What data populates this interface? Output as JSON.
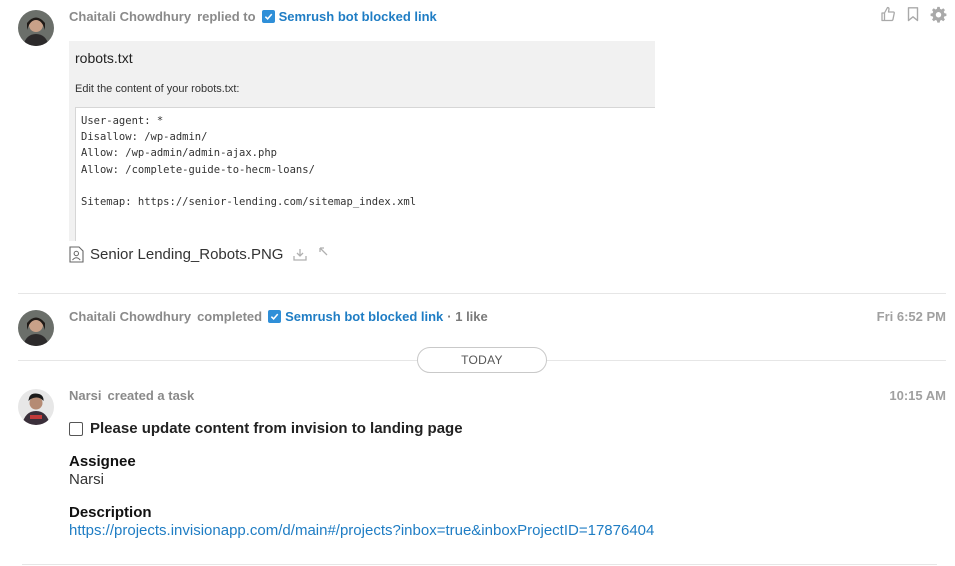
{
  "colors": {
    "accent": "#1f7dc4",
    "check_blue": "#2f8fd8",
    "meta_gray": "#8a8a8a",
    "divider": "#e6e6e6"
  },
  "entry1": {
    "author": "Chaitali Chowdhury",
    "action": "replied to",
    "task_name": "Semrush bot blocked link",
    "actions_icons": [
      "thumbs-up-icon",
      "bookmark-icon",
      "gear-icon"
    ],
    "screenshot": {
      "title": "robots.txt",
      "subtitle": "Edit the content of your robots.txt:",
      "content": "User-agent: *\nDisallow: /wp-admin/\nAllow: /wp-admin/admin-ajax.php\nAllow: /complete-guide-to-hecm-loans/\n\nSitemap: https://senior-lending.com/sitemap_index.xml"
    },
    "attachment": {
      "filename": "Senior Lending_Robots.PNG",
      "icons": [
        "image-file-icon",
        "download-icon",
        "expand-icon"
      ]
    }
  },
  "entry2": {
    "author": "Chaitali Chowdhury",
    "action": "completed",
    "task_name": "Semrush bot blocked link",
    "likes": "· 1 like",
    "timestamp": "Fri 6:52 PM"
  },
  "separator": {
    "label": "TODAY"
  },
  "entry3": {
    "author": "Narsi",
    "action": "created a task",
    "timestamp": "10:15 AM",
    "task_title": "Please update content from invision to landing page",
    "assignee_label": "Assignee",
    "assignee_value": "Narsi",
    "description_label": "Description",
    "description_value": "https://projects.invisionapp.com/d/main#/projects?inbox=true&inboxProjectID=17876404"
  }
}
